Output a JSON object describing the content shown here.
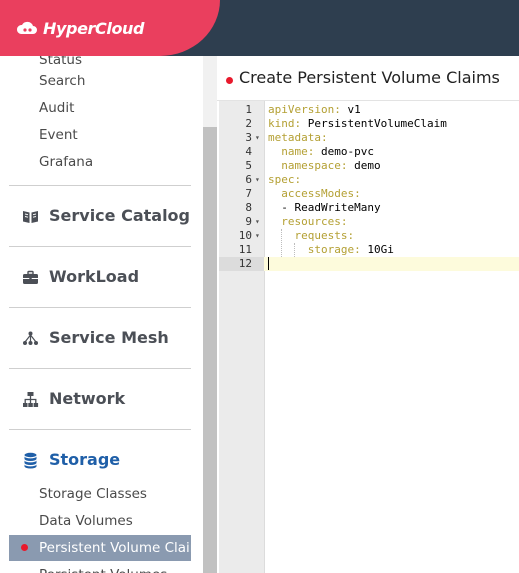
{
  "brand": {
    "name": "HyperCloud",
    "color": "#ea3f5e",
    "icon": "cloud-icon"
  },
  "header": {
    "background": "#2e3e4f"
  },
  "sidebar": {
    "top_items": [
      "Status",
      "Search",
      "Audit",
      "Event",
      "Grafana"
    ],
    "sections": [
      {
        "label": "Service Catalog",
        "icon": "book-icon"
      },
      {
        "label": "WorkLoad",
        "icon": "briefcase-icon"
      },
      {
        "label": "Service Mesh",
        "icon": "mesh-icon"
      },
      {
        "label": "Network",
        "icon": "network-icon"
      },
      {
        "label": "Storage",
        "icon": "database-icon",
        "active": true
      }
    ],
    "storage_items": [
      "Storage Classes",
      "Data Volumes",
      "Persistent Volume Claims",
      "Persistent Volumes"
    ],
    "selected_item": "Persistent Volume Claims",
    "active_color": "#1f5fa8",
    "selected_bg": "#8a9ab0"
  },
  "main": {
    "title": "Create Persistent Volume Claims",
    "editor": {
      "lines": [
        {
          "n": "1",
          "key": "apiVersion:",
          "value": " v1"
        },
        {
          "n": "2",
          "key": "kind:",
          "value": " PersistentVolumeClaim"
        },
        {
          "n": "3",
          "key": "metadata:",
          "value": "",
          "fold": true
        },
        {
          "n": "4",
          "key": "  name:",
          "value": " demo-pvc"
        },
        {
          "n": "5",
          "key": "  namespace:",
          "value": " demo"
        },
        {
          "n": "6",
          "key": "spec:",
          "value": "",
          "fold": true
        },
        {
          "n": "7",
          "key": "  accessModes:",
          "value": ""
        },
        {
          "n": "8",
          "key": "",
          "value": "  - ReadWriteMany"
        },
        {
          "n": "9",
          "key": "  resources:",
          "value": "",
          "fold": true
        },
        {
          "n": "10",
          "key": "    requests:",
          "value": "",
          "fold": true
        },
        {
          "n": "11",
          "key": "      storage:",
          "value": " 10Gi"
        },
        {
          "n": "12",
          "key": "",
          "value": "",
          "active": true
        }
      ],
      "key_color": "#b4a034",
      "active_line_color": "#fdfbdc"
    }
  }
}
